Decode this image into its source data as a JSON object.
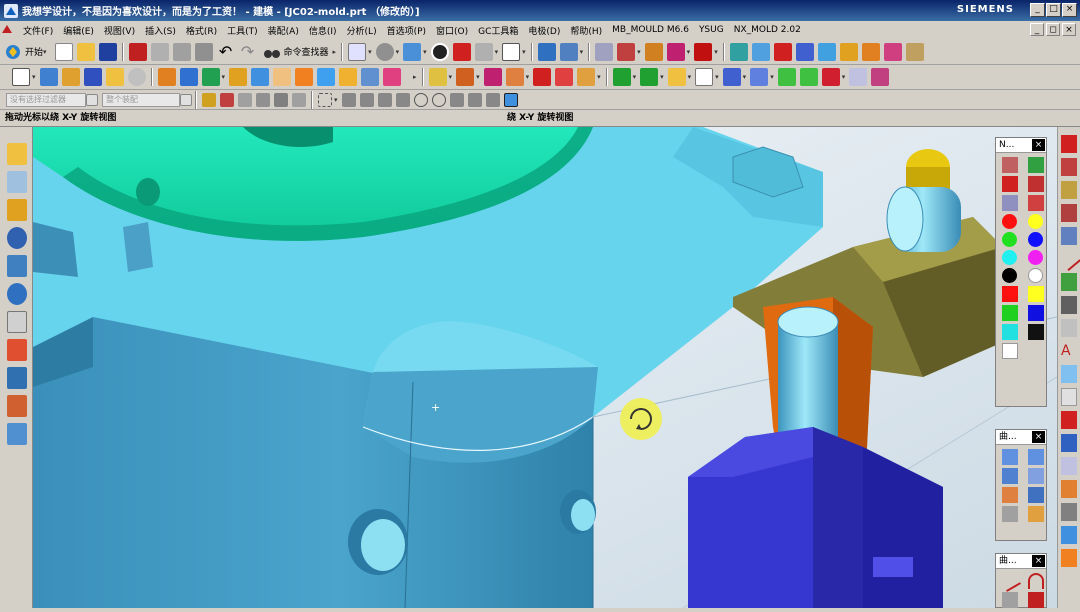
{
  "window": {
    "title": "我想学设计，不是因为喜欢设计，而是为了工资！ - 建模 - [JC02-mold.prt （修改的）]",
    "brand": "SIEMENS",
    "buttons": {
      "minimize": "_",
      "maximize": "□",
      "close": "×"
    }
  },
  "menu": {
    "items": [
      "文件(F)",
      "编辑(E)",
      "视图(V)",
      "插入(S)",
      "格式(R)",
      "工具(T)",
      "装配(A)",
      "信息(I)",
      "分析(L)",
      "首选项(P)",
      "窗口(O)",
      "GC工具箱",
      "电极(D)",
      "帮助(H)",
      "MB_MOULD M6.6",
      "YSUG",
      "NX_MOLD 2.02"
    ],
    "mdi_buttons": [
      "_",
      "◻",
      "×"
    ]
  },
  "toolbar": {
    "start_label": "开始",
    "command_finder_label": "命令查找器",
    "filter_combo_placeholder": "没有选择过滤器",
    "assembly_combo_placeholder": "整个装配"
  },
  "cue_line": {
    "left": "拖动光标以绕 X-Y 旋转视图",
    "center": "绕 X-Y 旋转视图"
  },
  "palettes": {
    "top": {
      "title": "N..."
    },
    "middle": {
      "title": "曲..."
    },
    "bottom": {
      "title": "曲..."
    },
    "close_glyph": "×"
  },
  "colors": {
    "accent": "#0a246a",
    "mint": "#1ee0b4",
    "steel": "#4aa6cc",
    "steel_light": "#67d4ee",
    "olive": "#6f6a2e",
    "orange": "#e06a10",
    "blue_block": "#3232c8",
    "gold": "#e8c810",
    "rotate_cursor": "#f0f050"
  },
  "icons": {
    "app": "nx-app-icon",
    "rotate_cursor": "rotate-view-icon"
  }
}
